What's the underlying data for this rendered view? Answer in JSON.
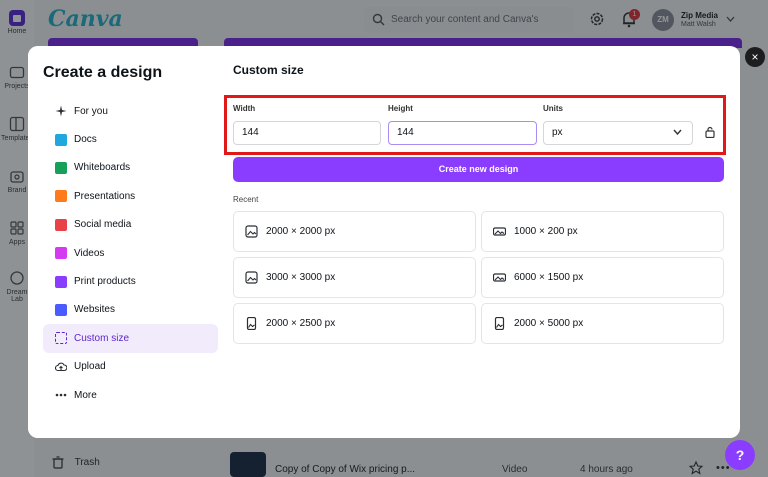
{
  "app": {
    "brand": "Canva",
    "rail": [
      {
        "label": "Home"
      },
      {
        "label": "Projects"
      },
      {
        "label": "Templates"
      },
      {
        "label": "Brand"
      },
      {
        "label": "Apps"
      },
      {
        "label": "Dream Lab"
      }
    ],
    "search": {
      "placeholder": "Search your content and Canva's"
    },
    "notifications": {
      "count": "1"
    },
    "account": {
      "avatar_initials": "ZM",
      "name": "Zip Media",
      "user": "Matt Walsh"
    },
    "sidebar_bottom": {
      "trash_label": "Trash"
    },
    "recent_file": {
      "name": "Copy of Copy of Wix pricing p...",
      "type": "Video",
      "time": "4 hours ago"
    },
    "help_label": "?",
    "accent_color": "#8b3dff"
  },
  "modal": {
    "title": "Create a design",
    "close_label": "×",
    "nav": [
      {
        "label": "For you",
        "icon": "sparkle-icon"
      },
      {
        "label": "Docs",
        "icon": "docs-icon"
      },
      {
        "label": "Whiteboards",
        "icon": "whiteboard-icon"
      },
      {
        "label": "Presentations",
        "icon": "presentation-icon"
      },
      {
        "label": "Social media",
        "icon": "heart-icon"
      },
      {
        "label": "Videos",
        "icon": "video-icon"
      },
      {
        "label": "Print products",
        "icon": "print-icon"
      },
      {
        "label": "Websites",
        "icon": "website-icon"
      },
      {
        "label": "Custom size",
        "icon": "custom-size-icon",
        "active": true
      },
      {
        "label": "Upload",
        "icon": "cloud-upload-icon"
      },
      {
        "label": "More",
        "icon": "more-dots-icon"
      }
    ],
    "custom": {
      "title": "Custom size",
      "width_label": "Width",
      "width_value": "144",
      "height_label": "Height",
      "height_value": "144",
      "units_label": "Units",
      "units_value": "px",
      "create_label": "Create new design",
      "recent_label": "Recent",
      "recent": [
        {
          "label": "2000 × 2000 px",
          "icon": "image-square-icon"
        },
        {
          "label": "1000 × 200 px",
          "icon": "image-wide-icon"
        },
        {
          "label": "3000 × 3000 px",
          "icon": "image-square-icon"
        },
        {
          "label": "6000 × 1500 px",
          "icon": "image-wide-icon"
        },
        {
          "label": "2000 × 2500 px",
          "icon": "image-portrait-icon"
        },
        {
          "label": "2000 × 5000 px",
          "icon": "image-portrait-icon"
        }
      ],
      "highlight_color": "#e01818"
    }
  }
}
